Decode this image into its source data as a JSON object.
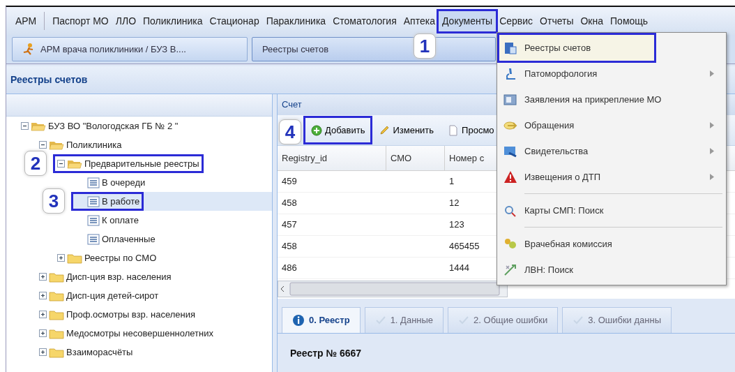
{
  "menu_bar": [
    {
      "label": "АРМ",
      "selected": false
    },
    {
      "label": "Паспорт МО",
      "selected": false
    },
    {
      "label": "ЛЛО",
      "selected": false
    },
    {
      "label": "Поликлиника",
      "selected": false
    },
    {
      "label": "Стационар",
      "selected": false
    },
    {
      "label": "Параклиника",
      "selected": false
    },
    {
      "label": "Стоматология",
      "selected": false
    },
    {
      "label": "Аптека",
      "selected": false
    },
    {
      "label": "Документы",
      "selected": true,
      "boxed": true,
      "callout": "1"
    },
    {
      "label": "Сервис",
      "selected": false
    },
    {
      "label": "Отчеты",
      "selected": false
    },
    {
      "label": "Окна",
      "selected": false
    },
    {
      "label": "Помощь",
      "selected": false
    }
  ],
  "window_tabs": [
    {
      "label": "АРМ врача поликлиники / БУЗ В....",
      "kind": "app",
      "selected": false
    },
    {
      "label": "Реестры счетов",
      "kind": "page",
      "selected": true
    }
  ],
  "panel_title": "Реестры счетов",
  "tree": [
    {
      "label": "БУЗ ВО \"Вологодская ГБ № 2 \"",
      "kind": "folder",
      "expanded": true,
      "selected": false,
      "children": [
        {
          "label": "Поликлиника",
          "kind": "folder",
          "expanded": true,
          "selected": false,
          "children": [
            {
              "label": "Предварительные реестры",
              "kind": "folder",
              "expanded": true,
              "selected": false,
              "boxed": true,
              "callout": "2",
              "children": [
                {
                  "label": "В очереди",
                  "kind": "list",
                  "selected": false
                },
                {
                  "label": "В работе",
                  "kind": "list",
                  "selected": true,
                  "boxed": true,
                  "callout": "3"
                },
                {
                  "label": "К оплате",
                  "kind": "list",
                  "selected": false
                },
                {
                  "label": "Оплаченные",
                  "kind": "list",
                  "selected": false
                }
              ]
            },
            {
              "label": "Реестры по СМО",
              "kind": "folder",
              "expanded": false,
              "selected": false
            }
          ]
        },
        {
          "label": "Дисп-ция взр. населения",
          "kind": "folder",
          "expanded": false,
          "selected": false
        },
        {
          "label": "Дисп-ция детей-сирот",
          "kind": "folder",
          "expanded": false,
          "selected": false
        },
        {
          "label": "Проф.осмотры взр. населения",
          "kind": "folder",
          "expanded": false,
          "selected": false
        },
        {
          "label": "Медосмотры несовершеннолетних",
          "kind": "folder",
          "expanded": false,
          "selected": false
        },
        {
          "label": "Взаиморасчёты",
          "kind": "folder",
          "expanded": false,
          "selected": false
        }
      ]
    }
  ],
  "grid": {
    "title": "Счет",
    "toolbar": [
      {
        "label": "Добавить",
        "boxed": true,
        "callout": "4"
      },
      {
        "label": "Изменить"
      },
      {
        "label": "Просмо"
      }
    ],
    "columns": [
      "Registry_id",
      "СМО",
      "Номер с"
    ],
    "rows": [
      {
        "registry_id": "459",
        "number": "1"
      },
      {
        "registry_id": "458",
        "number": "12"
      },
      {
        "registry_id": "457",
        "number": "123"
      },
      {
        "registry_id": "458",
        "number": "465455"
      },
      {
        "registry_id": "486",
        "number": "1444"
      }
    ]
  },
  "tabs": [
    {
      "label": "0. Реестр",
      "selected": true
    },
    {
      "label": "1. Данные",
      "selected": false
    },
    {
      "label": "2. Общие ошибки",
      "selected": false
    },
    {
      "label": "3. Ошибки данны",
      "selected": false
    }
  ],
  "registry_heading": "Реестр № 6667",
  "menu": [
    {
      "kind": "item",
      "label": "Реестры счетов",
      "submenu": false,
      "boxed": true
    },
    {
      "kind": "item",
      "label": "Патоморфология",
      "submenu": true
    },
    {
      "kind": "item",
      "label": "Заявления на прикрепление МО",
      "submenu": false
    },
    {
      "kind": "item",
      "label": "Обращения",
      "submenu": true
    },
    {
      "kind": "item",
      "label": "Свидетельства",
      "submenu": true
    },
    {
      "kind": "item",
      "label": "Извещения о ДТП",
      "submenu": true
    },
    {
      "kind": "separator"
    },
    {
      "kind": "item",
      "label": "Карты СМП: Поиск",
      "submenu": false
    },
    {
      "kind": "separator"
    },
    {
      "kind": "item",
      "label": "Врачебная комиссия",
      "submenu": false
    },
    {
      "kind": "item",
      "label": "ЛВН: Поиск",
      "submenu": false
    }
  ]
}
